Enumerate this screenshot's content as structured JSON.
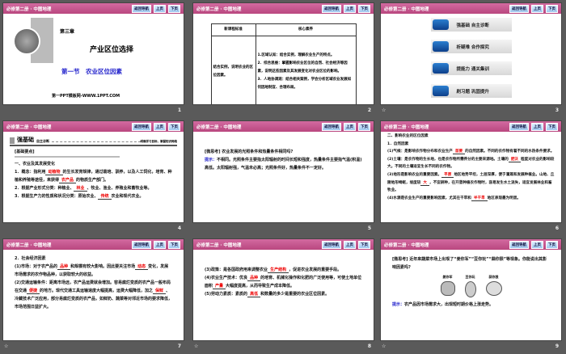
{
  "header": {
    "title": "必修第二册 · 中图地理",
    "nav_back": "返回导航",
    "prev": "上页",
    "next": "下页"
  },
  "slides": [
    {
      "number": "1",
      "chapter": "第三章",
      "title": "产业区位选择",
      "section": "第一节　农业区位因素",
      "footer": "第一PPT模板网-WWW.1PPT.COM"
    },
    {
      "number": "2",
      "col1": "新课程标准",
      "col2": "核心素养",
      "standard": "结合实例，说明农业的区位因素。",
      "lit": [
        "1.区域认知：结合实例，理解农业生产的特点。",
        "2．综合思维：掌握影响农业区位的自然、社会经济等因素，说明这些因素及其发展变化对农业区位的影响。",
        "3．人地协调观：结合相关案例，学会分析区域农业发展如何因地制宜、合理布局。"
      ]
    },
    {
      "number": "3",
      "menu": [
        "强基础 自主诊断",
        "析疑难 合作探究",
        "提能力 通关集训",
        "刷习题 巩固提升"
      ]
    },
    {
      "number": "4",
      "head": "强基础",
      "sub": "自主诊断",
      "right": "明确学习目标，掌握知识网络",
      "box": "[基础要点]",
      "h1": "一、农业及其发展变化",
      "l1a": "1．概念：指利用",
      "b1": "动植物",
      "l1b": "的生长发育规律，通过栽培、驯养，以及人工饲化，培育、种植和养殖等途径，来获得",
      "b2": "农产品",
      "l1c": "的物质生产部门。",
      "l2a": "2．根据产业形式分类：种植业、",
      "b3": "林业",
      "l2b": "、牧业、渔业、养殖业和畜牧业等。",
      "l3a": "3．根据生产力的性质和状况分类：原始农业、",
      "b4": "传统",
      "l3b": "农业和现代农业。"
    },
    {
      "number": "5",
      "q": "[微思考] 农业发展的光照条件和热量条件相同吗?",
      "tip": "提示：",
      "a": "不相同。光照条件主要指太阳辐射的时间长短和强度，热量条件主要指气温(积温)高低。太阳辐射强，气温未必高；光照条件好，热量条件不一定好。"
    },
    {
      "number": "6",
      "h1": "二、影响农业的区位因素",
      "h2": "1．自然因素",
      "p1a": "(1)气候：是影响农作物分布和农业生产",
      "b1": "首要",
      "p1b": "的自然因素。不同的农作物有着不同的水热条件要求。",
      "p2a": "(2)土壤：是农作物的生长地，也是农作物所需养分的主要来源地。土壤的",
      "b2": "肥沃",
      "p2b": "程度对农业的影响较大。不同的土壤适宜生长不同的农作物。",
      "p3a": "(3)地形是影响农业的重要因素。",
      "b3": "平原",
      "p3b": "地区地势平坦，土层深厚，便于灌溉和发展种植业。山地、丘陵地形崎岖，坡度较",
      "b4": "大",
      "p3c": "，不宜耕种，在开垦种植农作物时，容易发生水土流失，适宜发展林业和畜牧业。",
      "p4a": "(4)水源是农业生产的重要影响因素，尤其在干旱和",
      "b5": "半干旱",
      "p4b": "地区表现最为明显。"
    },
    {
      "number": "7",
      "h": "2．社会经济因素",
      "p1a": "(1)市场：对于农产品的",
      "b1": "品种",
      "p1b": "和规模有较大影响。因此要关注市场",
      "b2": "动态",
      "p1c": "变化，发展市场需求的农作物品种，以获取较大的收益。",
      "p2a": "(2)交通运输条件：距离市场远，农产品运费就会增加。容易腐烂变质的农产品一般布局在交通",
      "b3": "便捷",
      "p2b": "的地方。现代交通工具运输速度大幅提高，运费大幅降低，加之",
      "b4": "保鲜",
      "p2c": "、冷藏技术广泛应用，部分易腐烂变质的农产品，如鲜奶、蔬菜等对邻近市场的要求降低，市场范围日益扩大。"
    },
    {
      "number": "8",
      "p1a": "(3)政策：是各国政府用来调整农业",
      "b1": "生产结构",
      "p1b": "，促进农业发展的重要手段。",
      "p2a": "(4)农业生产技术：优良",
      "b2": "品种",
      "p2b": "的培育、机械化操作和化肥的广泛使用等，可使土地单位面积",
      "b3": "产量",
      "p2c": "大幅度提高，从而导致生产成本降低。",
      "p3a": "(5)劳动力素质：素质的",
      "b4": "高低",
      "p3b": "和数量的多少是重要的农业区位因素。"
    },
    {
      "number": "9",
      "q": "[微思考] 近年来蔬菜市场上出现了“姜你军”“豆你玩”“蒜你狠”等现象。你能说出其影响因素吗?",
      "labels": [
        "姜你军",
        "豆你玩",
        "蒜你狠"
      ],
      "tip": "提示：",
      "a": "农产品因市场需求大，出现短时期价格上涨走势。"
    }
  ],
  "star": "☆"
}
